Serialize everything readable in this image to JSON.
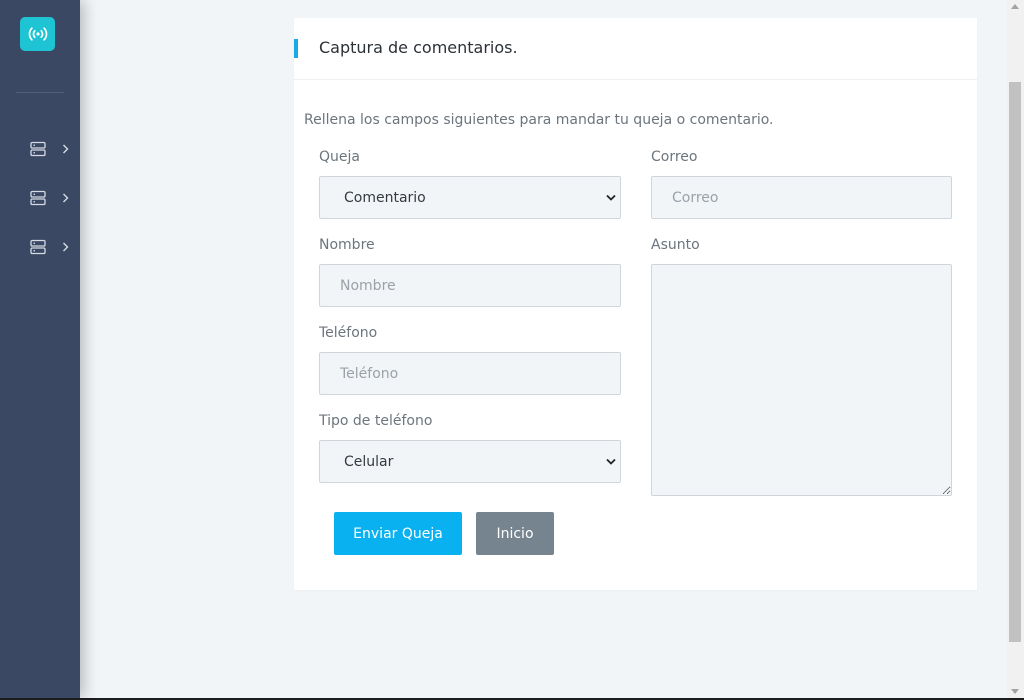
{
  "sidebar": {
    "logo_icon": "wireless-signal-icon",
    "items": [
      {
        "icon": "server-icon"
      },
      {
        "icon": "server-icon"
      },
      {
        "icon": "server-icon"
      }
    ]
  },
  "card": {
    "title": "Captura de comentarios.",
    "intro": "Rellena los campos siguientes para mandar tu queja o comentario."
  },
  "form": {
    "queja": {
      "label": "Queja",
      "value": "Comentario",
      "options": [
        "Comentario"
      ]
    },
    "correo": {
      "label": "Correo",
      "placeholder": "Correo",
      "value": ""
    },
    "nombre": {
      "label": "Nombre",
      "placeholder": "Nombre",
      "value": ""
    },
    "asunto": {
      "label": "Asunto",
      "value": ""
    },
    "telefono": {
      "label": "Teléfono",
      "placeholder": "Teléfono",
      "value": ""
    },
    "tipo_telefono": {
      "label": "Tipo de teléfono",
      "value": "Celular",
      "options": [
        "Celular"
      ]
    }
  },
  "buttons": {
    "submit": "Enviar Queja",
    "home": "Inicio"
  },
  "colors": {
    "sidebar": "#3b4863",
    "logo": "#1ec4d3",
    "accent": "#1aa8e8",
    "primary_button": "#0ab1f0",
    "secondary_button": "#75848f"
  }
}
